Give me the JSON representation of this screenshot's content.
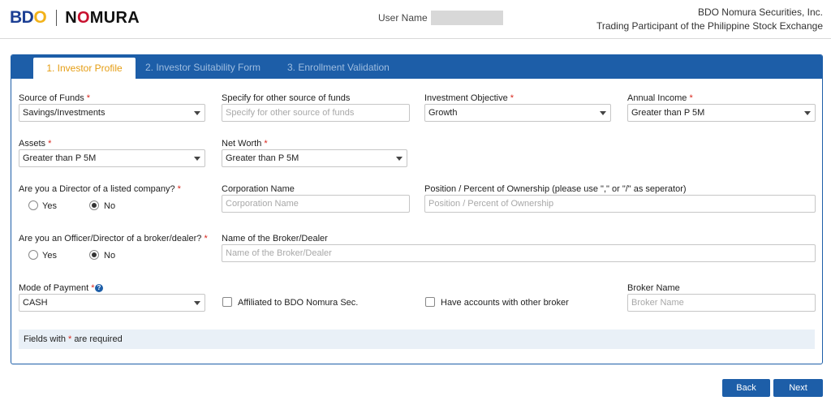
{
  "header": {
    "logo_bdo": "BDO",
    "logo_nomura": "NOMURA",
    "user_label": "User Name",
    "company_line1": "BDO Nomura Securities, Inc.",
    "company_line2": "Trading Participant of the Philippine Stock Exchange"
  },
  "tabs": [
    {
      "label": "1. Investor Profile",
      "active": true
    },
    {
      "label": "2. Investor Suitability Form",
      "active": false
    },
    {
      "label": "3. Enrollment Validation",
      "active": false
    }
  ],
  "form": {
    "source_of_funds": {
      "label": "Source of Funds",
      "value": "Savings/Investments"
    },
    "other_source": {
      "label": "Specify for other source of funds",
      "placeholder": "Specify for other source of funds"
    },
    "investment_objective": {
      "label": "Investment Objective",
      "value": "Growth"
    },
    "annual_income": {
      "label": "Annual Income",
      "value": "Greater than P 5M"
    },
    "assets": {
      "label": "Assets",
      "value": "Greater than P 5M"
    },
    "net_worth": {
      "label": "Net Worth",
      "value": "Greater than P 5M"
    },
    "director_listed": {
      "label": "Are you a Director of a listed company?",
      "yes": "Yes",
      "no": "No",
      "selected": "No"
    },
    "corporation_name": {
      "label": "Corporation Name",
      "placeholder": "Corporation Name"
    },
    "position_percent": {
      "label": "Position / Percent of Ownership (please use \",\" or \"/\" as seperator)",
      "placeholder": "Position / Percent of Ownership"
    },
    "officer_broker": {
      "label": "Are you an Officer/Director of a broker/dealer?",
      "yes": "Yes",
      "no": "No",
      "selected": "No"
    },
    "broker_dealer_name": {
      "label": "Name of the Broker/Dealer",
      "placeholder": "Name of the Broker/Dealer"
    },
    "mode_of_payment": {
      "label": "Mode of Payment",
      "value": "CASH"
    },
    "affiliated": {
      "label": "Affiliated to BDO Nomura Sec.",
      "checked": false
    },
    "other_broker": {
      "label": "Have accounts with other broker",
      "checked": false
    },
    "broker_name": {
      "label": "Broker Name",
      "placeholder": "Broker Name"
    }
  },
  "required_mark": "*",
  "note": {
    "prefix": "Fields with",
    "suffix": "are required"
  },
  "buttons": {
    "back": "Back",
    "next": "Next"
  },
  "colors": {
    "brand_blue": "#1d5ea8",
    "active_tab": "#e59d12",
    "required": "#d9261c"
  }
}
